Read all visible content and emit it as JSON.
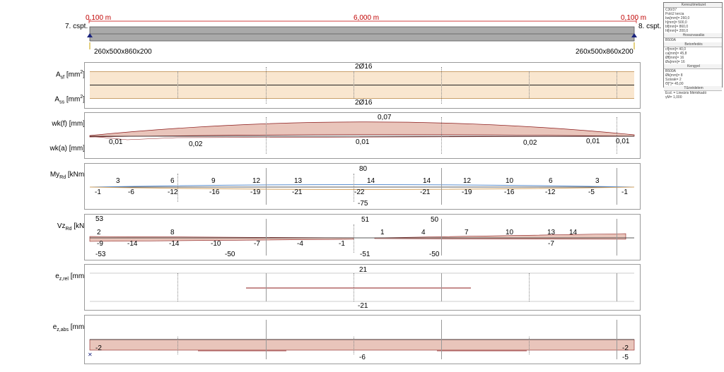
{
  "header": {
    "len_left": "0,100 m",
    "len_mid": "6,000 m",
    "len_right": "0,100 m",
    "node_left": "7. cspt.",
    "node_right": "8. cspt.",
    "section_left": "260x500x860x200",
    "section_right": "260x500x860x200"
  },
  "panels": {
    "as": {
      "label_top": "Asf [mm²]",
      "label_bottom": "Ass [mm²]",
      "top_value": "2Ø16",
      "bottom_value": "2Ø16"
    },
    "wk": {
      "label_top": "wk(f) [mm]",
      "label_bottom": "wk(a) [mm]",
      "values": [
        "0,07",
        "0,01",
        "0,02",
        "0,01",
        "0,02",
        "0,01",
        "0,01"
      ]
    },
    "my": {
      "label": "MyRd [kNm]",
      "max": "80",
      "min": "-75",
      "top_values": [
        "3",
        "6",
        "9",
        "12",
        "13",
        "14",
        "14",
        "12",
        "10",
        "6",
        "3"
      ],
      "bottom_values": [
        "-1",
        "-6",
        "-12",
        "-16",
        "-19",
        "-21",
        "-22",
        "-21",
        "-19",
        "-16",
        "-12",
        "-5",
        "-1"
      ]
    },
    "vz": {
      "label": "VzRd [kN]",
      "values_top": [
        "53",
        "51",
        "50"
      ],
      "values_mid_top": [
        "2",
        "8",
        "1",
        "4",
        "7",
        "10",
        "13",
        "14"
      ],
      "values_mid_bottom": [
        "-9",
        "-14",
        "-14",
        "-10",
        "-7",
        "-4",
        "-1",
        "-7"
      ],
      "values_bottom": [
        "-53",
        "-50",
        "-51",
        "-50"
      ]
    },
    "ezrel": {
      "label": "ez,rel [mm]",
      "max": "21",
      "min": "-21"
    },
    "ezabs": {
      "label": "ez,abs [mm]",
      "left": "-2",
      "right": "-2",
      "min": "-6",
      "right_bottom": "-5"
    }
  },
  "side_info": {
    "rows": [
      "Keresztmetszet",
      "C30/37",
      "Poló2 tercia",
      "bw[mm]= 260,0",
      "h[mm]= 500,0",
      "bf[mm]= 860,0",
      "hf[mm]= 200,0",
      "Hosszvasalás",
      "B500A",
      "Betonfedés",
      "cf[mm]= 40,0",
      "ca[mm]= 45,8",
      "Øf[mm]= 16",
      "Øa[mm]= 16",
      "Kengyel",
      "B500A",
      "Øk[mm]= 8",
      "Szárak= 2",
      "Θ[°]= 45,00",
      "Tűzvédelem",
      "Ecd. = Lineáris Mértékadó",
      "γM= 1,000"
    ]
  },
  "colors": {
    "fill": "#f9e6cf",
    "diagram_fill": "#e9c5bb",
    "diagram_stroke": "#8b1a1a",
    "blue": "#5b8fd0"
  }
}
